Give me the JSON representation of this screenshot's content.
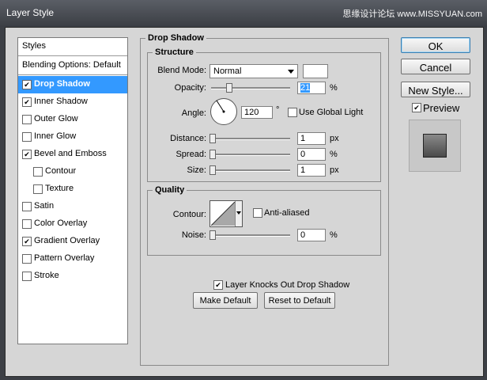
{
  "window": {
    "title": "Layer Style",
    "watermark": "思缘设计论坛 www.MISSYUAN.com"
  },
  "styles_panel": {
    "header": "Styles",
    "blending": "Blending Options: Default",
    "items": [
      {
        "label": "Drop Shadow",
        "checked": true,
        "selected": true,
        "indent": false
      },
      {
        "label": "Inner Shadow",
        "checked": true,
        "selected": false,
        "indent": false
      },
      {
        "label": "Outer Glow",
        "checked": false,
        "selected": false,
        "indent": false
      },
      {
        "label": "Inner Glow",
        "checked": false,
        "selected": false,
        "indent": false
      },
      {
        "label": "Bevel and Emboss",
        "checked": true,
        "selected": false,
        "indent": false
      },
      {
        "label": "Contour",
        "checked": false,
        "selected": false,
        "indent": true
      },
      {
        "label": "Texture",
        "checked": false,
        "selected": false,
        "indent": true
      },
      {
        "label": "Satin",
        "checked": false,
        "selected": false,
        "indent": false
      },
      {
        "label": "Color Overlay",
        "checked": false,
        "selected": false,
        "indent": false
      },
      {
        "label": "Gradient Overlay",
        "checked": true,
        "selected": false,
        "indent": false
      },
      {
        "label": "Pattern Overlay",
        "checked": false,
        "selected": false,
        "indent": false
      },
      {
        "label": "Stroke",
        "checked": false,
        "selected": false,
        "indent": false
      }
    ]
  },
  "drop_shadow": {
    "title": "Drop Shadow",
    "structure": {
      "title": "Structure",
      "blend_mode_label": "Blend Mode:",
      "blend_mode_value": "Normal",
      "opacity_label": "Opacity:",
      "opacity_value": "21",
      "opacity_unit": "%",
      "angle_label": "Angle:",
      "angle_value": "120",
      "angle_unit": "°",
      "use_global_light": "Use Global Light",
      "use_global_light_checked": false,
      "distance_label": "Distance:",
      "distance_value": "1",
      "distance_unit": "px",
      "spread_label": "Spread:",
      "spread_value": "0",
      "spread_unit": "%",
      "size_label": "Size:",
      "size_value": "1",
      "size_unit": "px"
    },
    "quality": {
      "title": "Quality",
      "contour_label": "Contour:",
      "anti_aliased": "Anti-aliased",
      "anti_aliased_checked": false,
      "noise_label": "Noise:",
      "noise_value": "0",
      "noise_unit": "%"
    },
    "knockout_label": "Layer Knocks Out Drop Shadow",
    "knockout_checked": true,
    "make_default": "Make Default",
    "reset_default": "Reset to Default"
  },
  "buttons": {
    "ok": "OK",
    "cancel": "Cancel",
    "new_style": "New Style...",
    "preview": "Preview",
    "preview_checked": true
  }
}
